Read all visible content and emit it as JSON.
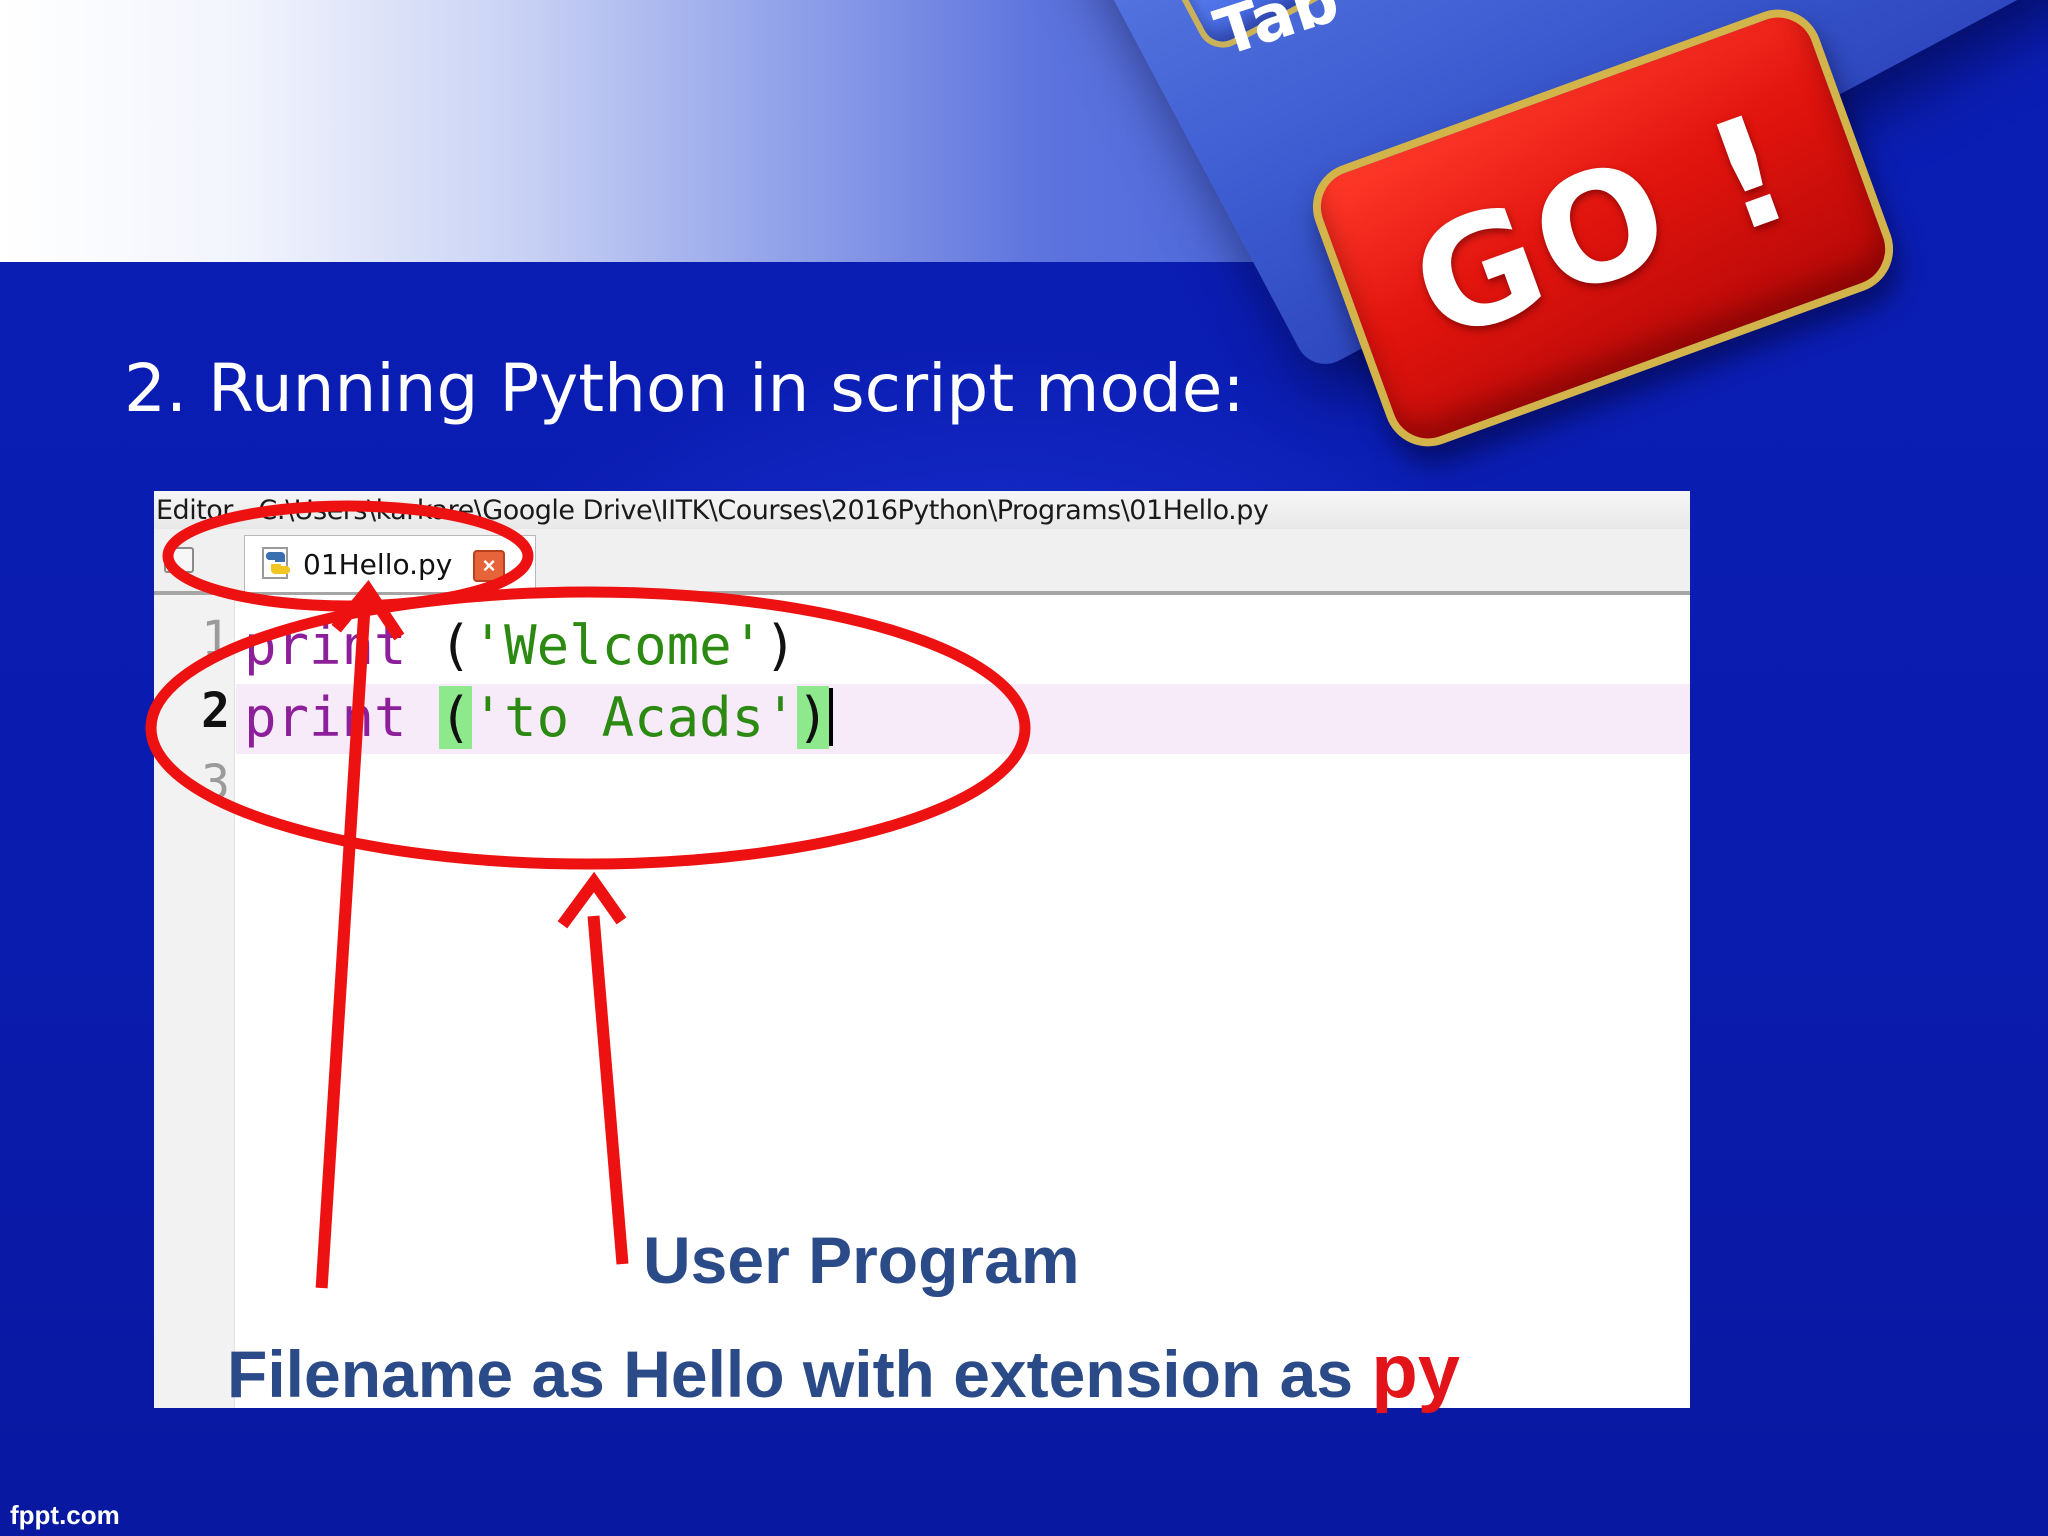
{
  "slide": {
    "title": "2. Running Python in script mode:",
    "go_key_label": "GO !",
    "tab_key_label": "Tab",
    "footer": "fppt.com"
  },
  "editor": {
    "window_title": "Editor - C:\\Users\\karkare\\Google Drive\\IITK\\Courses\\2016Python\\Programs\\01Hello.py",
    "tab": {
      "label": "01Hello.py",
      "icon": "python-file-icon",
      "close_icon": "close-icon"
    },
    "lines": [
      {
        "number": "1",
        "keyword": "print",
        "space": " ",
        "open_paren": "(",
        "string": "'Welcome'",
        "close_paren": ")"
      },
      {
        "number": "2",
        "keyword": "print",
        "space": " ",
        "open_paren": "(",
        "string": "'to Acads'",
        "close_paren": ")"
      },
      {
        "number": "3"
      }
    ],
    "active_line": 2,
    "colors": {
      "keyword": "#8d1f9a",
      "string": "#2c8a12",
      "paren_match": "#8ee88c",
      "current_line": "#f7eaf9"
    }
  },
  "annotations": {
    "user_program": "User Program",
    "filename_text": "Filename as Hello with extension as",
    "extension": "py",
    "annotation_color": "#2a4b88",
    "highlight_color": "#e3131a"
  }
}
